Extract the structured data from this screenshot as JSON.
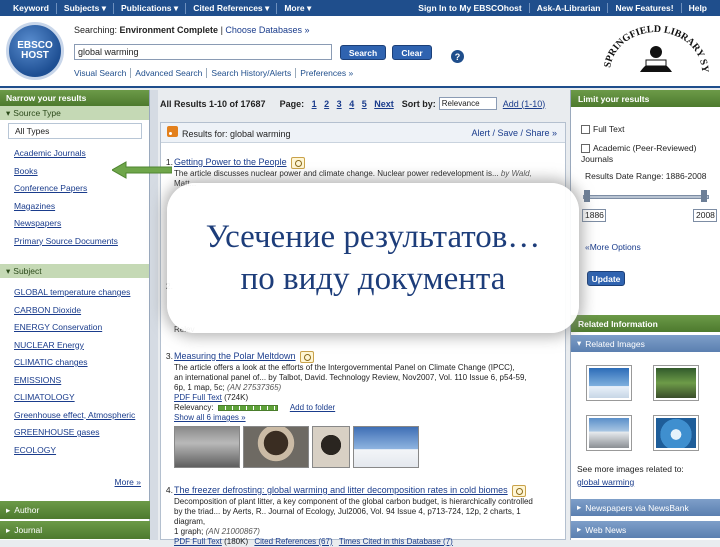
{
  "topnav": {
    "left": [
      "Keyword",
      "Subjects",
      "Publications",
      "Cited References",
      "More"
    ],
    "right": [
      "Sign In to My EBSCOhost",
      "Ask-A-Librarian",
      "New Features!",
      "Help"
    ]
  },
  "header": {
    "logo_text": "EBSCO HOST",
    "searching_label": "Searching:",
    "database": "Environment Complete",
    "choose_databases": "Choose Databases »",
    "query": "global warming",
    "search_btn": "Search",
    "clear_btn": "Clear",
    "help_glyph": "?",
    "links": [
      "Visual Search",
      "Advanced Search",
      "Search History/Alerts",
      "Preferences »"
    ],
    "library_logo_text": "SPRINGFIELD LIBRARY SYSTEM"
  },
  "left": {
    "narrow_head": "Narrow your results",
    "source_type_head": "Source Type",
    "all_types": "All Types",
    "source_types": [
      "Academic Journals",
      "Books",
      "Conference Papers",
      "Magazines",
      "Newspapers",
      "Primary Source Documents"
    ],
    "subject_head": "Subject",
    "subjects": [
      "GLOBAL temperature changes",
      "CARBON Dioxide",
      "ENERGY Conservation",
      "NUCLEAR Energy",
      "CLIMATIC changes",
      "EMISSIONS",
      "CLIMATOLOGY",
      "Greenhouse effect, Atmospheric",
      "GREENHOUSE gases",
      "ECOLOGY"
    ],
    "more": "More »",
    "author_head": "Author",
    "journal_head": "Journal"
  },
  "center": {
    "results_summary": "All Results 1-10 of 17687",
    "page_label": "Page:",
    "pages": [
      "1",
      "2",
      "3",
      "4",
      "5"
    ],
    "next": "Next",
    "sort_label": "Sort by:",
    "sort_value": "Relevance",
    "add_range": "Add (1-10)",
    "results_for": "Results for: global warming",
    "alert_share": "Alert / Save / Share »",
    "r1": {
      "num": "1.",
      "title": "Getting Power to the People",
      "abstract": "The article discusses nuclear power and climate change. Nuclear power redevelopment is...",
      "by": "by Wald,",
      "line2": "Matt..."
    },
    "r2": {
      "num": "2.",
      "relevancy_partial": "Relev"
    },
    "r3": {
      "num": "3.",
      "title": "Measuring the Polar Meltdown",
      "abstract1": "The article offers a look at the efforts of the Intergovernmental Panel on Climate Change (IPCC),",
      "abstract2": "an international panel of... by Talbot, David. Technology Review, Nov2007, Vol. 110 Issue 6, p54-59,",
      "abstract3": "6p, 1 map, 5c;",
      "an": "(AN 27537365)",
      "pdf": "PDF Full Text",
      "pdf_size": "(724K)",
      "relevancy_label": "Relevancy:",
      "add_folder": "Add to folder",
      "show_images": "Show all 6 images »"
    },
    "r4": {
      "num": "4.",
      "title": "The freezer defrosting: global warming and litter decomposition rates in cold biomes",
      "abstract1": "Decomposition of plant litter, a key component of the global carbon budget, is hierarchically controlled",
      "abstract2": "by the triad... by Aerts, R.. Journal of Ecology, Jul2006, Vol. 94 Issue 4, p713-724, 12p, 2 charts, 1 diagram,",
      "abstract3": "1 graph;",
      "an": "(AN 21000867)",
      "pdf": "PDF Full Text",
      "pdf_size": "(180K)",
      "cited": "Cited References (67)",
      "times_cited": "Times Cited in this Database (7)"
    }
  },
  "right": {
    "limit_head": "Limit your results",
    "full_text": "Full Text",
    "academic": "Academic (Peer-Reviewed) Journals",
    "date_range_label": "Results Date Range: 1886-2008",
    "date_from": "1886",
    "date_to": "2008",
    "more_options": "«More Options",
    "update": "Update",
    "related_info": "Related Information",
    "related_images": "Related Images",
    "see_more": "See more images related to:",
    "see_more_link": "global warming",
    "newspapers": "Newspapers via NewsBank",
    "web_news": "Web News"
  },
  "overlay": {
    "line1": "Усечение результатов…",
    "line2": "по виду документа"
  },
  "colors": {
    "nav_blue": "#1f4e8c",
    "panel_green": "#5b8a3a",
    "overlay_text": "#1d3d7a"
  }
}
